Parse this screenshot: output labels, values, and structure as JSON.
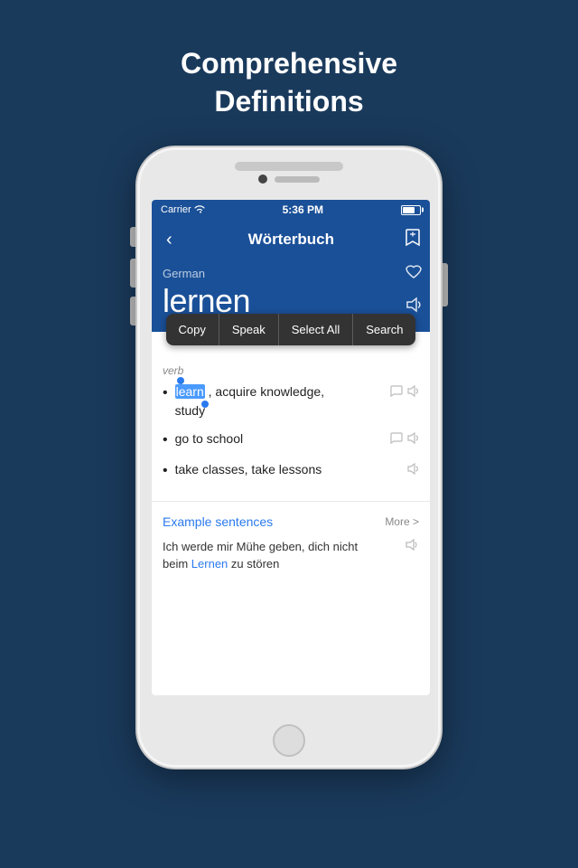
{
  "app": {
    "background_title_line1": "Comprehensive",
    "background_title_line2": "Definitions"
  },
  "status_bar": {
    "carrier": "Carrier",
    "wifi": "wifi",
    "time": "5:36 PM",
    "battery": "battery"
  },
  "nav": {
    "back_label": "‹",
    "title": "Wörterbuch",
    "bookmark_label": "bookmark"
  },
  "content": {
    "language": "German",
    "word": "lernen"
  },
  "context_menu": {
    "copy_label": "Copy",
    "speak_label": "Speak",
    "select_all_label": "Select All",
    "search_label": "Search"
  },
  "definitions": {
    "pos": "verb",
    "items": [
      {
        "text": "learn, acquire knowledge, study",
        "has_bubble": true,
        "has_speaker": true
      },
      {
        "text": "go to school",
        "has_bubble": true,
        "has_speaker": true
      },
      {
        "text": "take classes, take lessons",
        "has_bubble": false,
        "has_speaker": true
      }
    ]
  },
  "examples": {
    "title": "Example sentences",
    "more_label": "More >",
    "text_line1": "Ich werde mir Mühe geben, dich nicht",
    "text_line2": "beim",
    "link_word": "Lernen",
    "text_line3": "zu stören"
  }
}
